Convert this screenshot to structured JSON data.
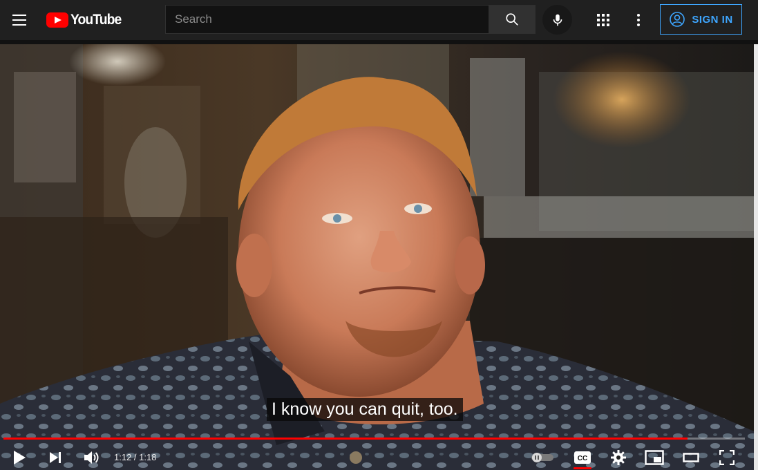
{
  "header": {
    "logo_text": "YouTube",
    "search_placeholder": "Search",
    "signin_label": "SIGN IN"
  },
  "player": {
    "caption": "I know you can quit, too.",
    "current_time": "1:12",
    "duration": "1:18",
    "time_display": "1:12 / 1:18",
    "progress_fraction": 0.923,
    "captions_on": true,
    "autoplay_on": false
  },
  "colors": {
    "accent": "#ff0000",
    "signin_blue": "#3ea6ff",
    "masthead_bg": "#202020"
  },
  "icons": [
    "menu-icon",
    "youtube-logo-icon",
    "search-icon",
    "mic-icon",
    "apps-icon",
    "more-vert-icon",
    "account-icon",
    "play-icon",
    "next-icon",
    "volume-icon",
    "autoplay-toggle-icon",
    "cc-icon",
    "settings-icon",
    "miniplayer-icon",
    "theater-icon",
    "fullscreen-icon"
  ]
}
